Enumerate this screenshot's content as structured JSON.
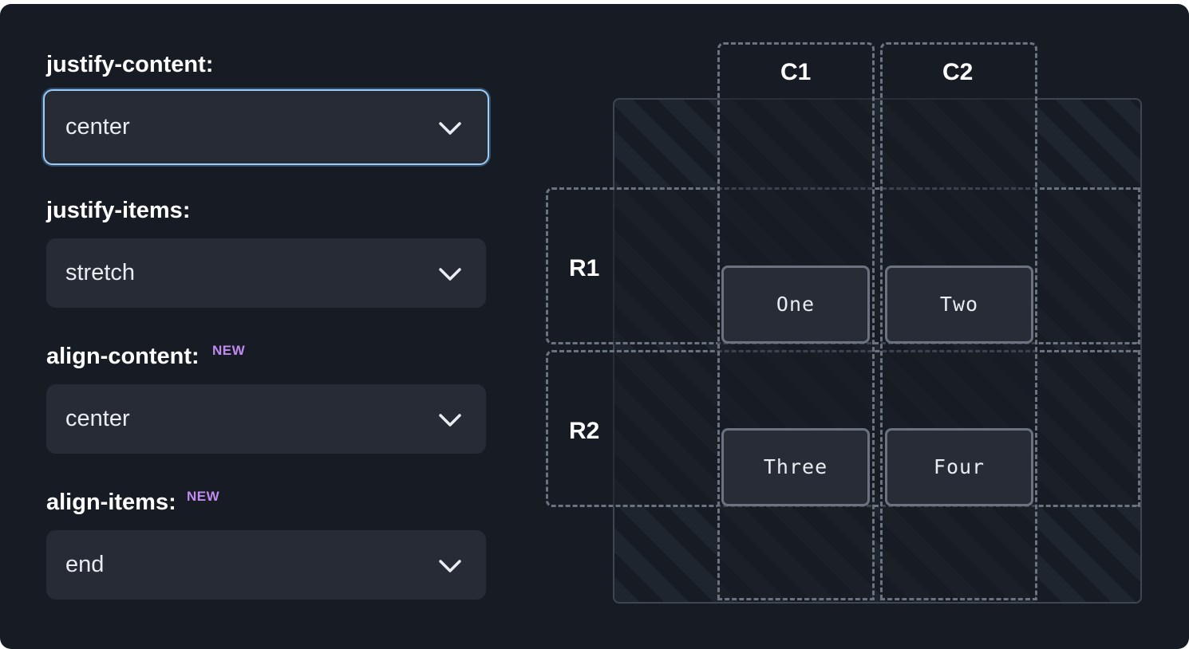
{
  "controls": [
    {
      "label": "justify-content:",
      "value": "center",
      "badge": ""
    },
    {
      "label": "justify-items:",
      "value": "stretch",
      "badge": ""
    },
    {
      "label": "align-content:",
      "value": "center",
      "badge": "NEW"
    },
    {
      "label": "align-items:",
      "value": "end",
      "badge": "NEW"
    }
  ],
  "grid": {
    "columns": [
      "C1",
      "C2"
    ],
    "rows": [
      "R1",
      "R2"
    ],
    "items": [
      "One",
      "Two",
      "Three",
      "Four"
    ]
  },
  "icons": {
    "select_chevron": "chevron-down-icon"
  },
  "colors": {
    "background": "#171c24",
    "select_bg": "#262b36",
    "focus_ring": "#9ccbf5",
    "badge": "#c08af0",
    "track_border": "#6b7380"
  }
}
